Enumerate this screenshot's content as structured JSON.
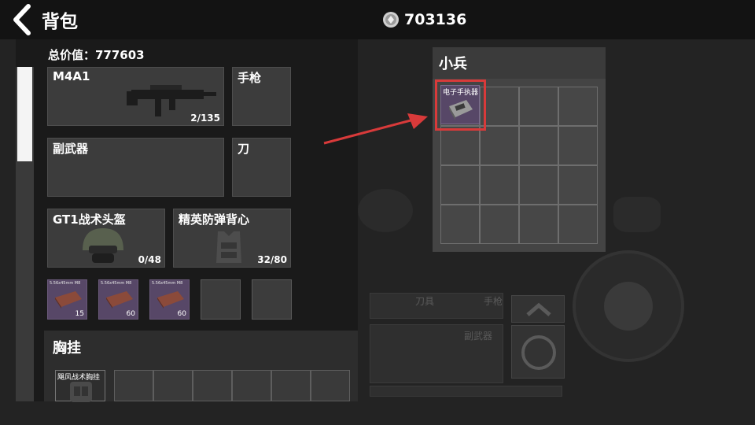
{
  "header": {
    "title": "背包",
    "currency_value": "703136"
  },
  "inventory": {
    "total_value_text": "总价值：777603",
    "primary_weapon": {
      "label": "M4A1",
      "ammo": "2/135"
    },
    "pistol": {
      "label": "手枪"
    },
    "secondary_weapon": {
      "label": "副武器"
    },
    "knife": {
      "label": "刀"
    },
    "helmet": {
      "label": "GT1战术头盔",
      "durability": "0/48"
    },
    "armor": {
      "label": "精英防弹背心",
      "durability": "32/80"
    },
    "ammo_slots": [
      {
        "name": "5.56x45mm M8",
        "count": "15"
      },
      {
        "name": "5.56x45mm M8",
        "count": "60"
      },
      {
        "name": "5.56x45mm M8",
        "count": "60"
      }
    ],
    "chest_rig": {
      "title": "胸挂",
      "item_label": "飓风战术胸挂"
    }
  },
  "container": {
    "title": "小兵",
    "item_label": "电子手执器"
  },
  "hud": {
    "knife_label": "刀具",
    "pistol_label": "手枪",
    "secondary_label": "副武器"
  },
  "icons": {
    "back": "chevron-left-icon",
    "currency": "coin-icon",
    "arrow": "red-arrow"
  },
  "colors": {
    "highlight": "#d83a3a",
    "ammo_bg": "#574767"
  }
}
